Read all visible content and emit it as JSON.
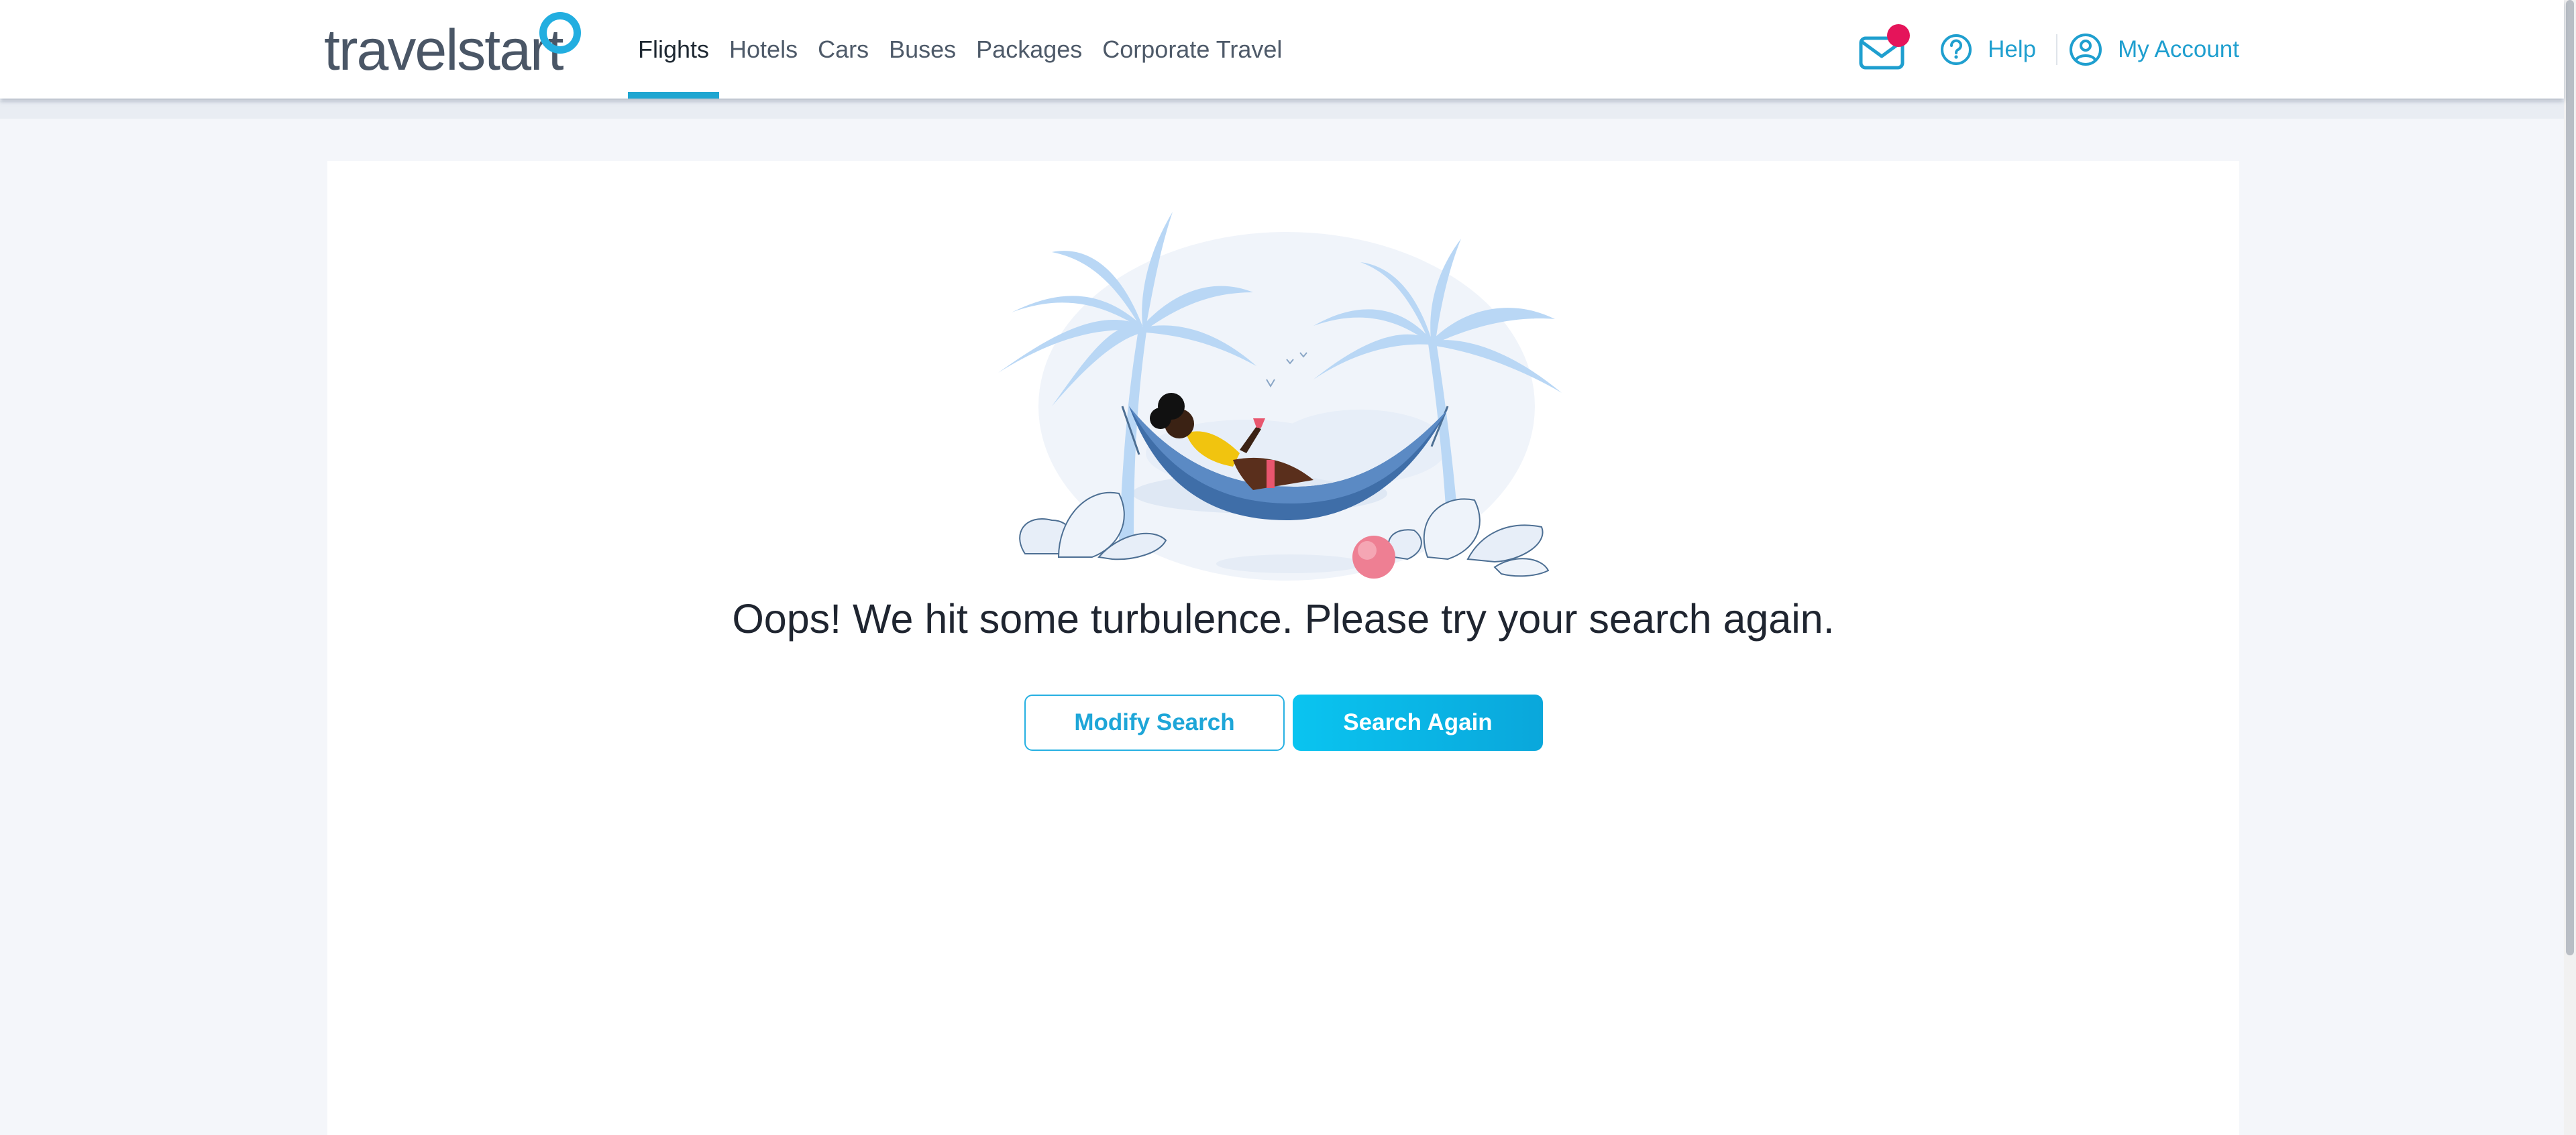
{
  "brand": {
    "logo_text": "travelstart",
    "accent_color": "#22aee0",
    "notification_color": "#e5145a"
  },
  "nav": {
    "items": [
      {
        "label": "Flights",
        "active": true
      },
      {
        "label": "Hotels",
        "active": false
      },
      {
        "label": "Cars",
        "active": false
      },
      {
        "label": "Buses",
        "active": false
      },
      {
        "label": "Packages",
        "active": false
      },
      {
        "label": "Corporate Travel",
        "active": false
      }
    ]
  },
  "header_actions": {
    "mail_icon": "envelope-icon",
    "help_label": "Help",
    "help_icon": "question-circle-icon",
    "account_label": "My Account",
    "account_icon": "user-circle-icon"
  },
  "error_page": {
    "illustration": "person-in-hammock-between-palm-trees",
    "message": "Oops! We hit some turbulence. Please try your search again.",
    "modify_button": "Modify Search",
    "search_again_button": "Search Again"
  }
}
